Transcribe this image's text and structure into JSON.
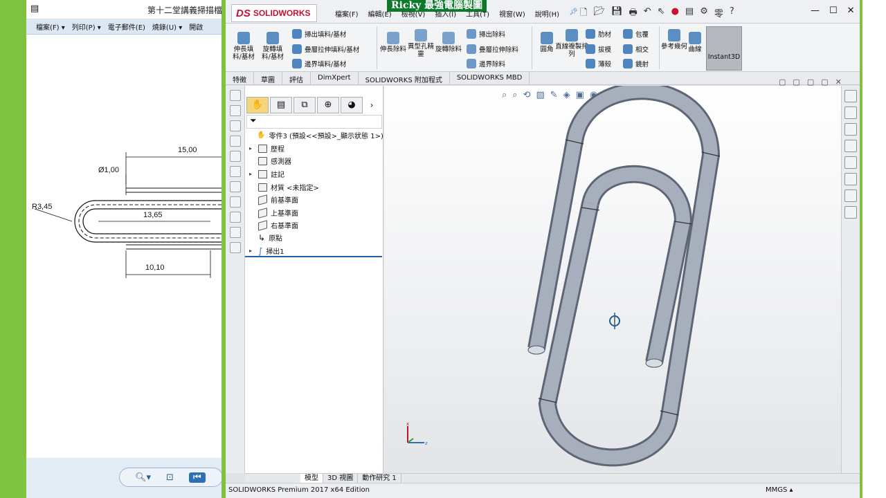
{
  "doc": {
    "title": "第十二堂講義掃描檔",
    "menu": [
      "檔案(F) ▾",
      "列印(P) ▾",
      "電子郵件(E)",
      "燒錄(U) ▾",
      "開啟"
    ],
    "dims": {
      "d1": "15,00",
      "d2": "Ø1,00",
      "d3": "R3,45",
      "d4": "13,65",
      "d5": "10,10"
    }
  },
  "banner": "Ricky 最強電腦製圖",
  "app": {
    "logo": "SOLIDWORKS",
    "menus": [
      "檔案(F)",
      "編輯(E)",
      "檢視(V)",
      "插入(I)",
      "工具(T)",
      "視窗(W)",
      "說明(H)"
    ],
    "status_text": "SOLIDWORKS Premium 2017 x64 Edition",
    "units": "MMGS ▴"
  },
  "commands": {
    "big": [
      "伸長填料/基材",
      "旋轉填料/基材",
      "伸長除料",
      "異型孔精靈",
      "旋轉除料",
      "圓角",
      "直線複製排列",
      "參考幾何",
      "曲線"
    ],
    "small": [
      "掃出填料/基材",
      "疊層拉伸填料/基材",
      "邊界填料/基材",
      "掃出除料",
      "疊層拉伸除料",
      "邊界除料",
      "肋材",
      "拔模",
      "薄殼",
      "包覆",
      "相交",
      "鏡射"
    ],
    "instant3d": "Instant3D"
  },
  "tabs": [
    "特徵",
    "草圖",
    "評估",
    "DimXpert",
    "SOLIDWORKS 附加程式",
    "SOLIDWORKS MBD"
  ],
  "tree": {
    "root": "零件3 (預設<<預設>_顯示狀態 1>)",
    "items": [
      "歷程",
      "感測器",
      "註記",
      "材質 <未指定>",
      "前基準面",
      "上基準面",
      "右基準面",
      "原點",
      "掃出1"
    ]
  },
  "bottom_tabs": [
    "模型",
    "3D 視圖",
    "動作研究 1"
  ],
  "colors": {
    "accent": "#7fc241",
    "banner": "#0a7a2a",
    "brand": "#c8102e",
    "model": "#9aa3b2"
  }
}
